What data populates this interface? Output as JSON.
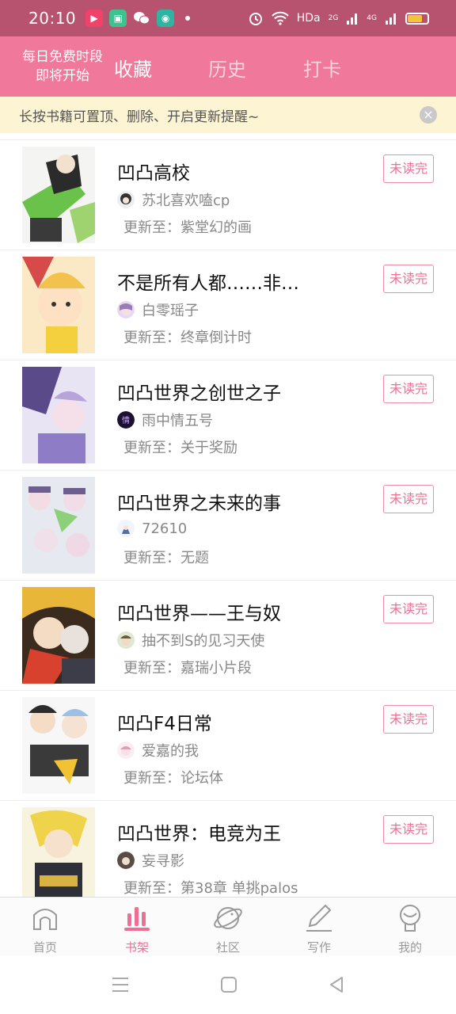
{
  "status_bar": {
    "time": "20:10",
    "network_label": "HDa",
    "signal_1": "2G",
    "signal_2": "4G",
    "battery_color": "#f3c63a",
    "battery_level": 0.75,
    "apps": [
      "video-app-icon",
      "store-app-icon",
      "wechat-icon",
      "camera-app-icon"
    ]
  },
  "header": {
    "promo_line1": "每日免费时段",
    "promo_line2": "即将开始",
    "tabs": [
      {
        "label": "收藏",
        "active": true
      },
      {
        "label": "历史",
        "active": false
      },
      {
        "label": "打卡",
        "active": false
      }
    ]
  },
  "tip": {
    "text": "长按书籍可置顶、删除、开启更新提醒~"
  },
  "books": [
    {
      "title": "凹凸高校",
      "author": "苏北喜欢嗑cp",
      "update": "更新至：紫堂幻的画",
      "badge": "未读完"
    },
    {
      "title": "不是所有人都……非…",
      "author": "白零瑶子",
      "update": "更新至：终章倒计时",
      "badge": "未读完"
    },
    {
      "title": "凹凸世界之创世之子",
      "author": "雨中情五号",
      "update": "更新至：关于奖励",
      "badge": "未读完"
    },
    {
      "title": "凹凸世界之未来的事",
      "author": "72610",
      "update": "更新至：无题",
      "badge": "未读完"
    },
    {
      "title": "凹凸世界——王与奴",
      "author": "抽不到S的见习天使",
      "update": "更新至：嘉瑞小片段",
      "badge": "未读完"
    },
    {
      "title": "凹凸F4日常",
      "author": "爱嘉的我",
      "update": "更新至：论坛体",
      "badge": "未读完"
    },
    {
      "title": "凹凸世界：电竞为王",
      "author": "妄寻影",
      "update": "更新至：第38章 单挑palos",
      "badge": "未读完"
    }
  ],
  "bottom_nav": [
    {
      "label": "首页",
      "icon": "home-icon",
      "active": false
    },
    {
      "label": "书架",
      "icon": "bookshelf-icon",
      "active": true
    },
    {
      "label": "社区",
      "icon": "planet-icon",
      "active": false
    },
    {
      "label": "写作",
      "icon": "pen-icon",
      "active": false
    },
    {
      "label": "我的",
      "icon": "profile-icon",
      "active": false
    }
  ],
  "colors": {
    "brand_pink": "#f0789a",
    "status_bar": "#b7536f",
    "tip_bg": "#fdf4d4",
    "accent_text": "#ee6f93"
  }
}
